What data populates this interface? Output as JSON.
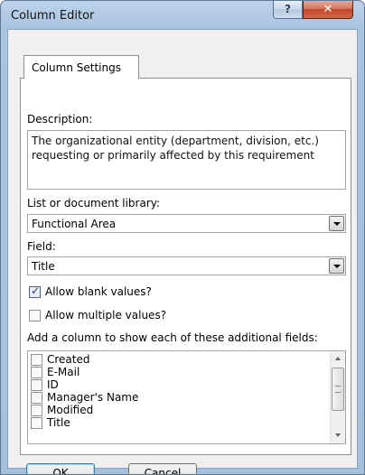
{
  "window": {
    "title": "Column Editor",
    "help_glyph": "?",
    "close_glyph": "✕"
  },
  "tab": {
    "label": "Column Settings"
  },
  "description": {
    "label": "Description:",
    "value": "The organizational entity (department, division, etc.) requesting or primarily affected by this requirement"
  },
  "list_library": {
    "label": "List or document library:",
    "selected": "Functional Area"
  },
  "field": {
    "label": "Field:",
    "selected": "Title"
  },
  "options": {
    "allow_blank": {
      "label": "Allow blank values?",
      "checked": true
    },
    "allow_multiple": {
      "label": "Allow multiple values?",
      "checked": false
    }
  },
  "additional_fields": {
    "label": "Add a column to show each of these additional fields:",
    "items": [
      {
        "label": "Created",
        "checked": false
      },
      {
        "label": "E-Mail",
        "checked": false
      },
      {
        "label": "ID",
        "checked": false
      },
      {
        "label": "Manager's Name",
        "checked": false
      },
      {
        "label": "Modified",
        "checked": false
      },
      {
        "label": "Title",
        "checked": false
      }
    ]
  },
  "buttons": {
    "ok": "OK",
    "cancel": "Cancel"
  },
  "colors": {
    "title_bar": "#a9c3e1",
    "close_button": "#c2462b",
    "default_button_border": "#3c7fb1"
  }
}
